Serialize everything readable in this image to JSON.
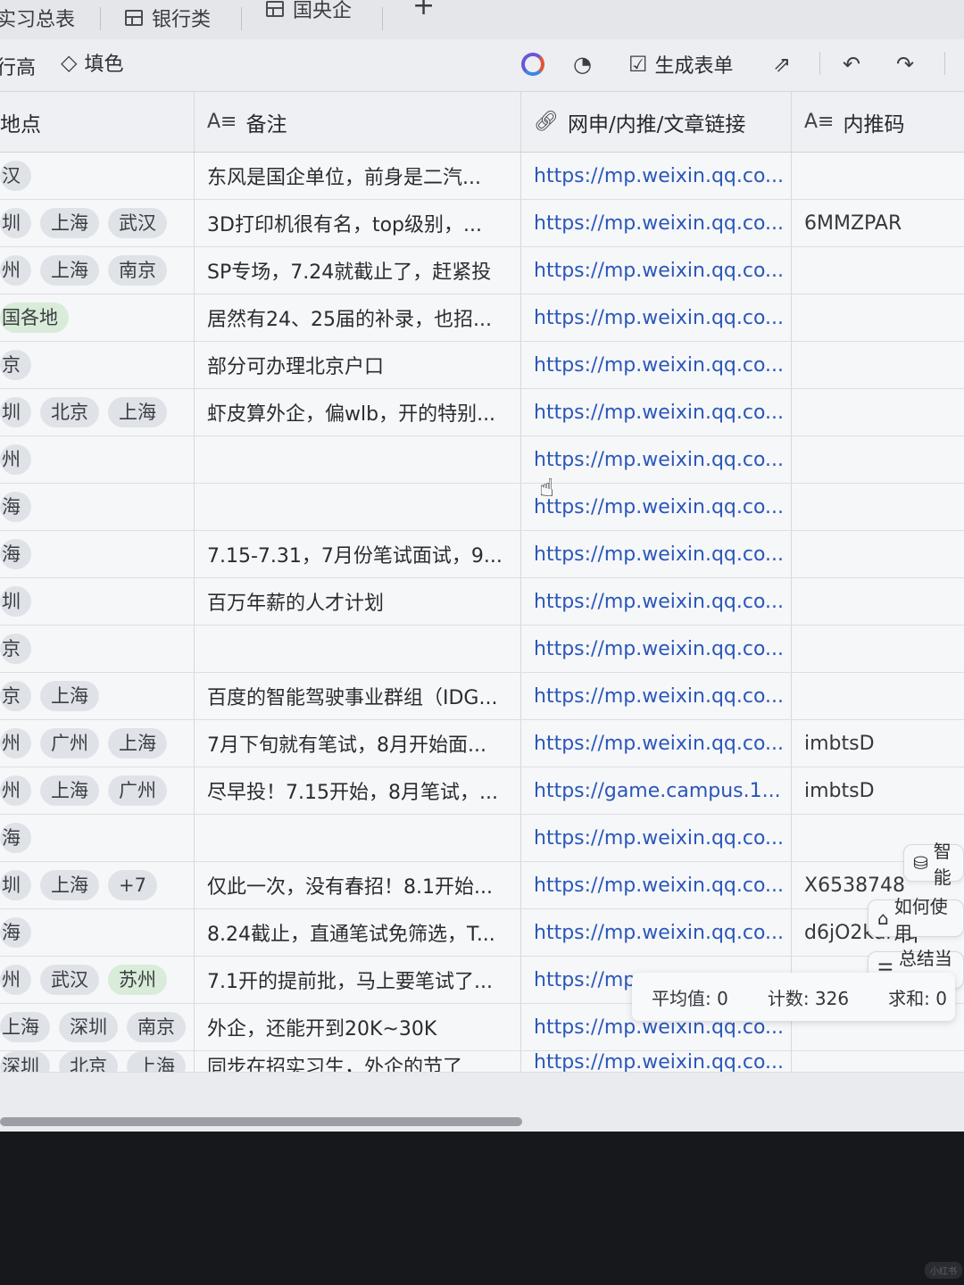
{
  "tabs": [
    {
      "label": "实习总表"
    },
    {
      "label": "银行类"
    },
    {
      "label": "国央企"
    },
    {
      "label": "+"
    }
  ],
  "toolbar": {
    "row_height": "行高",
    "fill": "填色",
    "generate_form": "生成表单"
  },
  "columns": {
    "location": "地点",
    "note": "备注",
    "link": "网申/内推/文章链接",
    "code": "内推码"
  },
  "rows": [
    {
      "tags": [
        "汉"
      ],
      "note": "东风是国企单位，前身是二汽...",
      "link": "https://mp.weixin.qq.co...",
      "code": ""
    },
    {
      "tags": [
        "圳",
        "上海",
        "武汉"
      ],
      "note": "3D打印机很有名，top级别，...",
      "link": "https://mp.weixin.qq.co...",
      "code": "6MMZPAR"
    },
    {
      "tags": [
        "州",
        "上海",
        "南京"
      ],
      "note": "SP专场，7.24就截止了，赶紧投",
      "link": "https://mp.weixin.qq.co...",
      "code": ""
    },
    {
      "tags": [
        "国各地"
      ],
      "note": "居然有24、25届的补录，也招...",
      "link": "https://mp.weixin.qq.co...",
      "code": ""
    },
    {
      "tags": [
        "京"
      ],
      "note": "部分可办理北京户口",
      "link": "https://mp.weixin.qq.co...",
      "code": ""
    },
    {
      "tags": [
        "圳",
        "北京",
        "上海"
      ],
      "note": "虾皮算外企，偏wlb，开的特别...",
      "link": "https://mp.weixin.qq.co...",
      "code": ""
    },
    {
      "tags": [
        "州"
      ],
      "note": "",
      "link": "https://mp.weixin.qq.co...",
      "code": ""
    },
    {
      "tags": [
        "海"
      ],
      "note": "",
      "link": "https://mp.weixin.qq.co...",
      "code": ""
    },
    {
      "tags": [
        "海"
      ],
      "note": "7.15-7.31，7月份笔试面试，9...",
      "link": "https://mp.weixin.qq.co...",
      "code": ""
    },
    {
      "tags": [
        "圳"
      ],
      "note": "百万年薪的人才计划",
      "link": "https://mp.weixin.qq.co...",
      "code": ""
    },
    {
      "tags": [
        "京"
      ],
      "note": "",
      "link": "https://mp.weixin.qq.co...",
      "code": ""
    },
    {
      "tags": [
        "京",
        "上海"
      ],
      "note": "百度的智能驾驶事业群组（IDG...",
      "link": "https://mp.weixin.qq.co...",
      "code": ""
    },
    {
      "tags": [
        "州",
        "广州",
        "上海"
      ],
      "note": "7月下旬就有笔试，8月开始面...",
      "link": "https://mp.weixin.qq.co...",
      "code": "imbtsD"
    },
    {
      "tags": [
        "州",
        "上海",
        "广州"
      ],
      "note": "尽早投！7.15开始，8月笔试，...",
      "link": "https://game.campus.1...",
      "code": "imbtsD"
    },
    {
      "tags": [
        "海"
      ],
      "note": "",
      "link": "https://mp.weixin.qq.co...",
      "code": ""
    },
    {
      "tags": [
        "圳",
        "上海",
        "+7"
      ],
      "note": "仅此一次，没有春招！8.1开始...",
      "link": "https://mp.weixin.qq.co...",
      "code": "X6538748"
    },
    {
      "tags": [
        "海"
      ],
      "note": "8.24截止，直通笔试免筛选，T...",
      "link": "https://mp.weixin.qq.co...",
      "code": "d6jO2kurqq"
    },
    {
      "tags": [
        "州",
        "武汉",
        "苏州"
      ],
      "note": "7.1开的提前批，马上要笔试了...",
      "link": "https://mp",
      "code": ""
    },
    {
      "tags": [
        "上海",
        "深圳",
        "南京"
      ],
      "note": "外企，还能开到20K~30K",
      "link": "https://mp.weixin.qq.co...",
      "code": ""
    },
    {
      "tags": [
        "深圳",
        "北京",
        "上海"
      ],
      "note": "同步在招实习生，外企的节了",
      "link": "https://mp.weixin.qq.co...",
      "code": ""
    }
  ],
  "stats": {
    "average": "平均值: 0",
    "count": "计数: 326",
    "sum": "求和: 0"
  },
  "assistant": {
    "smart": "智能",
    "how_to_use": "如何使用",
    "summarize": "总结当前"
  },
  "watermark": "小红书",
  "colors": {
    "link": "#2a57b8",
    "tag_default": "#dfe3e8",
    "tag_green": "#d8ecd9"
  }
}
